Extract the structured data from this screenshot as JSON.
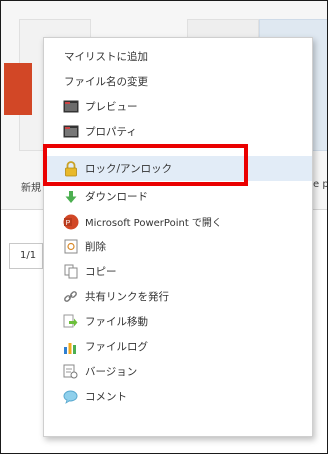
{
  "background": {
    "left_file_label": "新規",
    "right_file_label": "e p",
    "pager_label": "1/1"
  },
  "menu": {
    "items": [
      {
        "label": "マイリストに追加",
        "icon": ""
      },
      {
        "label": "ファイル名の変更",
        "icon": ""
      },
      {
        "label": "プレビュー",
        "icon": "preview-icon"
      },
      {
        "label": "プロパティ",
        "icon": "properties-icon"
      },
      {
        "label": "ロック/アンロック",
        "icon": "lock-icon"
      },
      {
        "label": "ダウンロード",
        "icon": "download-icon"
      },
      {
        "label": "Microsoft PowerPoint で開く",
        "icon": "powerpoint-icon"
      },
      {
        "label": "削除",
        "icon": "delete-icon"
      },
      {
        "label": "コピー",
        "icon": "copy-icon"
      },
      {
        "label": "共有リンクを発行",
        "icon": "share-link-icon"
      },
      {
        "label": "ファイル移動",
        "icon": "move-file-icon"
      },
      {
        "label": "ファイルログ",
        "icon": "file-log-icon"
      },
      {
        "label": "バージョン",
        "icon": "version-icon"
      },
      {
        "label": "コメント",
        "icon": "comment-icon"
      }
    ],
    "highlighted_index": 4
  },
  "colors": {
    "highlight_border": "#ea0000",
    "highlight_bg": "#e2ecf7",
    "powerpoint": "#d24726"
  }
}
